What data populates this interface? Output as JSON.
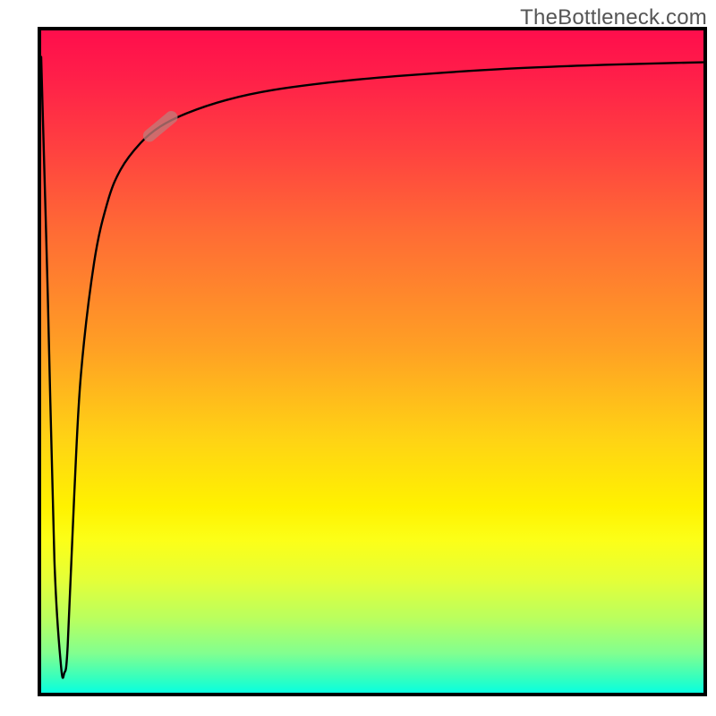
{
  "watermark": "TheBottleneck.com",
  "chart_data": {
    "type": "line",
    "title": "",
    "xlabel": "",
    "ylabel": "",
    "xlim": [
      0,
      100
    ],
    "ylim": [
      0,
      100
    ],
    "grid": false,
    "legend": false,
    "background_gradient": {
      "direction": "vertical",
      "stops": [
        {
          "y": 100,
          "color": "#ff0e4c"
        },
        {
          "y": 50,
          "color": "#ffa024"
        },
        {
          "y": 28,
          "color": "#fff200"
        },
        {
          "y": 10,
          "color": "#b8ff60"
        },
        {
          "y": 0,
          "color": "#08ffe0"
        }
      ]
    },
    "series": [
      {
        "name": "curve",
        "x": [
          0,
          1,
          2,
          3,
          3.5,
          4,
          5,
          6,
          8,
          10,
          12,
          15,
          18,
          22,
          28,
          35,
          45,
          55,
          70,
          85,
          100
        ],
        "y": [
          96,
          60,
          20,
          4,
          3,
          7,
          30,
          48,
          65,
          74,
          79,
          83,
          85.5,
          87.5,
          89.5,
          91,
          92.3,
          93.2,
          94.2,
          94.8,
          95.2
        ]
      }
    ],
    "annotations": [
      {
        "name": "highlight-marker",
        "shape": "pill",
        "cx": 18,
        "cy": 85.5,
        "color": "#c27a78"
      }
    ]
  },
  "colors": {
    "axis": "#000000",
    "curve": "#000000",
    "marker": "#c27a78",
    "watermark_text": "#555555"
  }
}
